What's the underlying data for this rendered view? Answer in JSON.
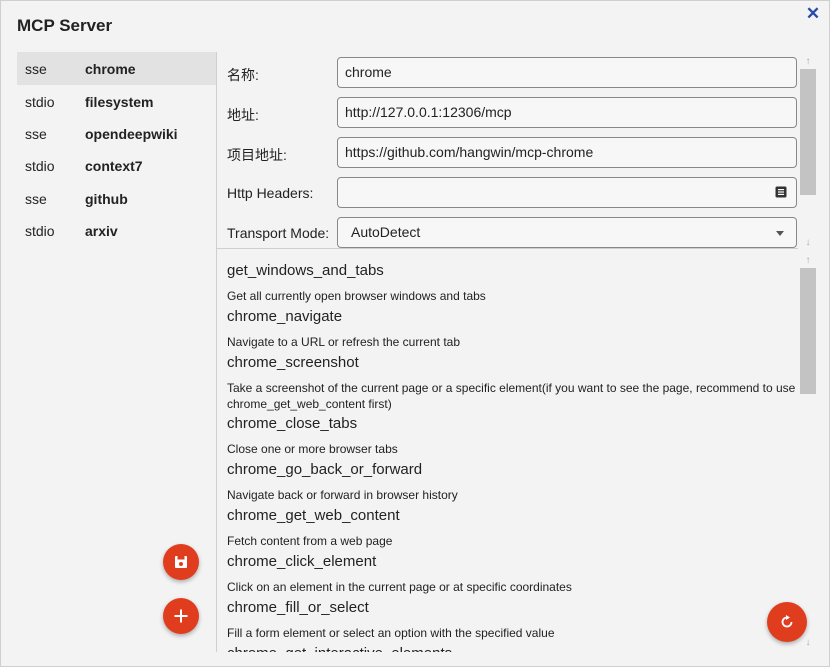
{
  "window": {
    "title": "MCP Server"
  },
  "servers": [
    {
      "type": "sse",
      "name": "chrome"
    },
    {
      "type": "stdio",
      "name": "filesystem"
    },
    {
      "type": "sse",
      "name": "opendeepwiki"
    },
    {
      "type": "stdio",
      "name": "context7"
    },
    {
      "type": "sse",
      "name": "github"
    },
    {
      "type": "stdio",
      "name": "arxiv"
    }
  ],
  "form": {
    "name_label": "名称:",
    "name_value": "chrome",
    "address_label": "地址:",
    "address_value": "http://127.0.0.1:12306/mcp",
    "project_label": "项目地址:",
    "project_value": "https://github.com/hangwin/mcp-chrome",
    "headers_label": "Http Headers:",
    "headers_value": "",
    "transport_label": "Transport Mode:",
    "transport_value": "AutoDetect"
  },
  "tools": [
    {
      "name": "get_windows_and_tabs",
      "desc": "Get all currently open browser windows and tabs"
    },
    {
      "name": "chrome_navigate",
      "desc": "Navigate to a URL or refresh the current tab"
    },
    {
      "name": "chrome_screenshot",
      "desc": "Take a screenshot of the current page or a specific element(if you want to see the page, recommend to use chrome_get_web_content first)"
    },
    {
      "name": "chrome_close_tabs",
      "desc": "Close one or more browser tabs"
    },
    {
      "name": "chrome_go_back_or_forward",
      "desc": "Navigate back or forward in browser history"
    },
    {
      "name": "chrome_get_web_content",
      "desc": "Fetch content from a web page"
    },
    {
      "name": "chrome_click_element",
      "desc": "Click on an element in the current page or at specific coordinates"
    },
    {
      "name": "chrome_fill_or_select",
      "desc": "Fill a form element or select an option with the specified value"
    },
    {
      "name": "chrome_get_interactive_elements",
      "desc": ""
    }
  ],
  "icons": {
    "close": "close-icon",
    "save": "save-icon",
    "add": "plus-icon",
    "refresh": "refresh-icon",
    "headers": "list-icon",
    "dropdown": "chevron-down-icon"
  },
  "colors": {
    "accent": "#e03d1e",
    "close": "#2a4aa8",
    "selected": "#e2e2e2"
  }
}
